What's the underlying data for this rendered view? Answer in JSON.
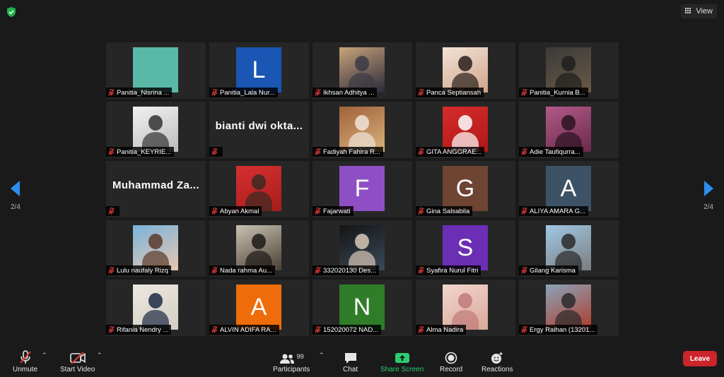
{
  "header": {
    "view_label": "View"
  },
  "nav": {
    "page_left": "2/4",
    "page_right": "2/4"
  },
  "tiles": [
    {
      "name": "Panitia_Nisrina ...",
      "kind": "color",
      "color": "#5ab8a6",
      "letter": ""
    },
    {
      "name": "Panitia_Lala Nur...",
      "kind": "color",
      "color": "#1a56b4",
      "letter": "L"
    },
    {
      "name": "Ikhsan Adhitya ...",
      "kind": "photo",
      "c1": "#c9a37a",
      "c2": "#2a2a3a",
      "c3": "#3a3a45"
    },
    {
      "name": "Panca Septiansah",
      "kind": "photo",
      "c1": "#f3e2d6",
      "c2": "#cfa58a",
      "c3": "#2a1f1a"
    },
    {
      "name": "Panitia_Kurnia B...",
      "kind": "photo",
      "c1": "#3a3a3a",
      "c2": "#6b5a44",
      "c3": "#1e1e1e"
    },
    {
      "name": "Panitia_KEYRIE...",
      "kind": "photo",
      "c1": "#f2f2f2",
      "c2": "#bcbcbc",
      "c3": "#333333"
    },
    {
      "name": "",
      "kind": "text",
      "display": "bianti dwi okta..."
    },
    {
      "name": "Fadiyah Fahira R...",
      "kind": "photo",
      "c1": "#a0623a",
      "c2": "#d9b27e",
      "c3": "#f0e4d8"
    },
    {
      "name": "GITA ANGGRAE...",
      "kind": "photo",
      "c1": "#d62b2b",
      "c2": "#b01818",
      "c3": "#ffffff"
    },
    {
      "name": "Adie Taufiqurra...",
      "kind": "photo",
      "c1": "#b25a88",
      "c2": "#6a2a4a",
      "c3": "#2a1420"
    },
    {
      "name": "",
      "kind": "text",
      "display": "Muhammad Za..."
    },
    {
      "name": "Abyan Akmal",
      "kind": "photo",
      "c1": "#d63030",
      "c2": "#a81c1c",
      "c3": "#3a2a22"
    },
    {
      "name": "Fajarwati",
      "kind": "color",
      "color": "#8e4fc4",
      "letter": "F"
    },
    {
      "name": "Gina Salsabila",
      "kind": "color",
      "color": "#6d4532",
      "letter": "G"
    },
    {
      "name": "ALIYA AMARA G...",
      "kind": "color",
      "color": "#3d5365",
      "letter": "A"
    },
    {
      "name": "Lulu naufaly Rizq",
      "kind": "photo",
      "c1": "#7ab4dc",
      "c2": "#e8c7b0",
      "c3": "#5a3a2a"
    },
    {
      "name": "Nada rahma Au...",
      "kind": "photo",
      "c1": "#c9c2b2",
      "c2": "#4a3f35",
      "c3": "#1e1a18"
    },
    {
      "name": "332020130 Des...",
      "kind": "photo",
      "c1": "#141414",
      "c2": "#3a4a5a",
      "c3": "#d8c8b8"
    },
    {
      "name": "Syafira Nurul Fitri",
      "kind": "color",
      "color": "#6b2fb5",
      "letter": "S"
    },
    {
      "name": "Gilang Karisma",
      "kind": "photo",
      "c1": "#9ec8e6",
      "c2": "#7d7d7d",
      "c3": "#2a2a2a"
    },
    {
      "name": "Rifania Nendry ...",
      "kind": "photo",
      "c1": "#ece8e0",
      "c2": "#d4cfc4",
      "c3": "#1c2a44"
    },
    {
      "name": "ALVIN ADIFA RA...",
      "kind": "color",
      "color": "#ef6c0a",
      "letter": "A"
    },
    {
      "name": "152020072 NAD...",
      "kind": "color",
      "color": "#2f7d28",
      "letter": "N"
    },
    {
      "name": "Alma Nadira",
      "kind": "photo",
      "c1": "#f2d6cc",
      "c2": "#d9a89a",
      "c3": "#c07a7a"
    },
    {
      "name": "Ergy Raihan (13201...",
      "kind": "photo",
      "c1": "#8aa4b8",
      "c2": "#b03a2a",
      "c3": "#2a2a2a"
    }
  ],
  "toolbar": {
    "unmute_label": "Unmute",
    "start_video_label": "Start Video",
    "participants_label": "Participants",
    "participants_count": "99",
    "chat_label": "Chat",
    "share_label": "Share Screen",
    "record_label": "Record",
    "reactions_label": "Reactions",
    "leave_label": "Leave"
  },
  "colors": {
    "accent": "#2e8ef0",
    "share_green": "#2ecc71",
    "leave_red": "#c9252a",
    "mic_red": "#e23b3b"
  }
}
